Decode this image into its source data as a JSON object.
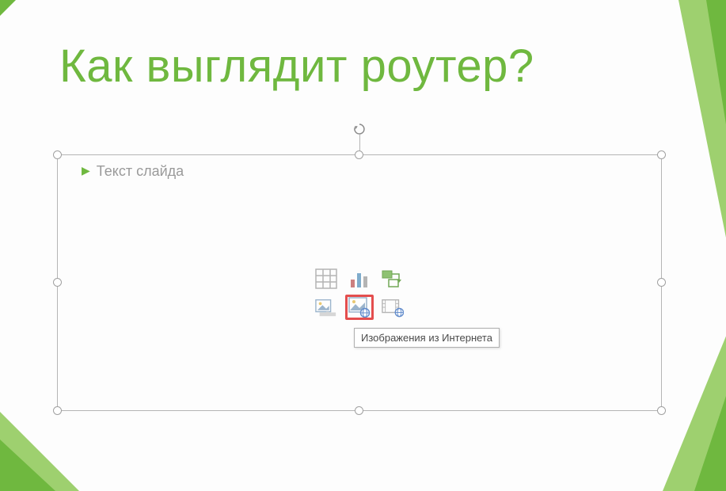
{
  "title": "Как выглядит роутер?",
  "content_placeholder": "Текст слайда",
  "tooltip": "Изображения из Интернета",
  "colors": {
    "accent": "#6fb83f",
    "highlight": "#e03030"
  },
  "icons": {
    "row1": [
      "insert-table-icon",
      "insert-chart-icon",
      "insert-smartart-icon"
    ],
    "row2": [
      "insert-picture-icon",
      "insert-online-picture-icon",
      "insert-video-icon"
    ]
  }
}
